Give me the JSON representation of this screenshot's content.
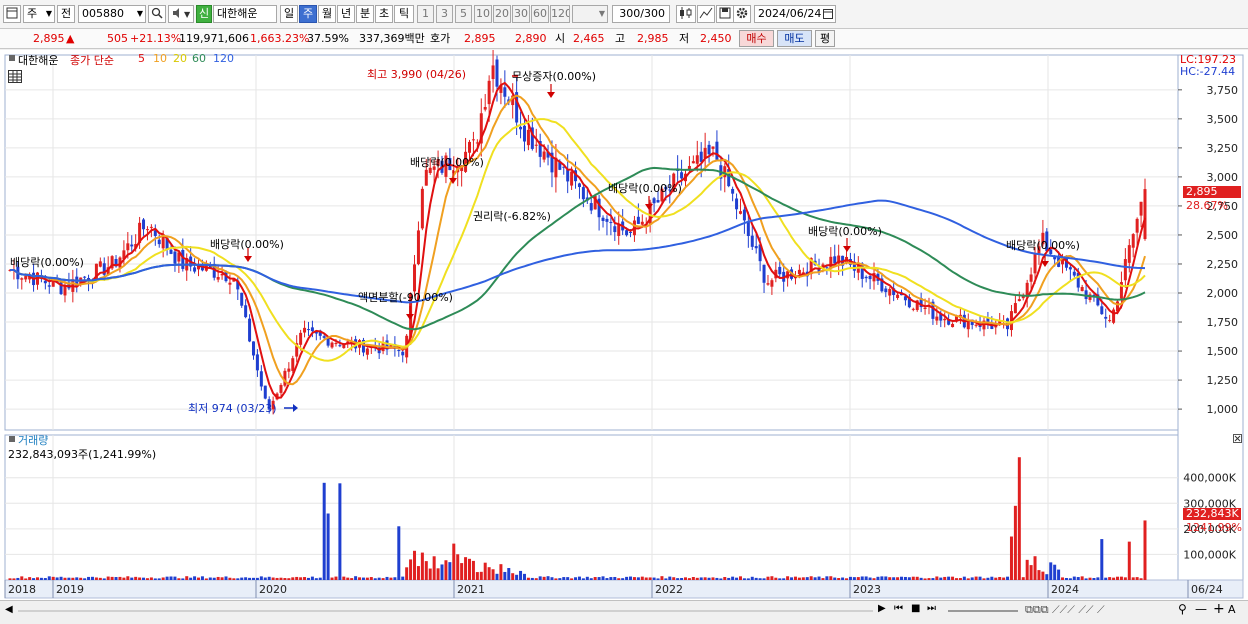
{
  "toolbar": {
    "market": "주",
    "prev": "전",
    "code": "005880",
    "new_badge": "신",
    "name": "대한해운",
    "periods": [
      "일",
      "주",
      "월",
      "년",
      "분",
      "초",
      "틱"
    ],
    "active_period": "주",
    "intervals": [
      "1",
      "3",
      "5",
      "10",
      "20",
      "30",
      "60",
      "120"
    ],
    "count": "300",
    "count_total": "/300",
    "date": "2024/06/24"
  },
  "quote": {
    "price": "2,895",
    "arrow": "▲",
    "change": "505",
    "change_pct": "+21.13%",
    "volume": "119,971,606",
    "volume_pct": "1,663.23%",
    "turnover": "37.59%",
    "amount": "337,369백만",
    "hoga_label": "호가",
    "ask": "2,895",
    "bid": "2,890",
    "open_label": "시",
    "open": "2,465",
    "high_label": "고",
    "high": "2,985",
    "low_label": "저",
    "low": "2,450",
    "buy": "매수",
    "sell": "매도",
    "eval": "평"
  },
  "price_panel": {
    "name": "대한해운",
    "ma_title": "종가 단순",
    "ma_periods": [
      "5",
      "10",
      "20",
      "60",
      "120"
    ],
    "lc": "LC:197.23",
    "hc": "HC:-27.44",
    "current_price": "2,895",
    "current_pct": "28.67%",
    "annotations": {
      "high": "최고 3,990 (04/26)",
      "low": "최저 974 (03/23)",
      "div1": "배당락(0.00%)",
      "div2": "배당락(0.00%)",
      "split": "액면분할(-90.00%)",
      "div3": "배당락(0.00%)",
      "rights": "권리락(-6.82%)",
      "bonus": "무상증자(0.00%)",
      "div4": "배당락(0.00%)",
      "div5": "배당락(0.00%)",
      "div6": "배당락(0.00%)"
    }
  },
  "volume_panel": {
    "title": "거래량",
    "value": "232,843,093주(1,241.99%)",
    "current": "232,843K",
    "current_pct": "1241.99%"
  },
  "colors": {
    "up": "#e02020",
    "down": "#1f3fd0",
    "ma5": "#e01010",
    "ma10": "#f0a020",
    "ma20": "#f0e020",
    "ma60": "#2e8b57",
    "ma120": "#3060e0"
  },
  "chart_data": {
    "type": "candlestick",
    "interval": "weekly",
    "price_axis": {
      "ticks": [
        1000,
        1250,
        1500,
        1750,
        2000,
        2250,
        2500,
        2750,
        3000,
        3250,
        3500,
        3750
      ],
      "range": [
        820,
        4050
      ]
    },
    "price_tick_labels": [
      "1,000",
      "1,250",
      "1,500",
      "1,750",
      "2,000",
      "2,250",
      "2,500",
      "2,750",
      "3,000",
      "3,250",
      "3,500",
      "3,750"
    ],
    "volume_axis": {
      "ticks": [
        100000,
        200000,
        300000,
        400000
      ],
      "unit": "K"
    },
    "volume_tick_labels": [
      "100,000K",
      "200,000K",
      "300,000K",
      "400,000K"
    ],
    "x_labels": [
      "2018",
      "2019",
      "2020",
      "2021",
      "2022",
      "2023",
      "2024",
      "06/24"
    ],
    "ohlc_anchors": [
      {
        "date": "2018-12",
        "close": 2200
      },
      {
        "date": "2019-03",
        "close": 2050
      },
      {
        "date": "2019-06",
        "close": 2250
      },
      {
        "date": "2019-08",
        "close": 2600
      },
      {
        "date": "2019-10",
        "close": 2250
      },
      {
        "date": "2020-01",
        "close": 2150
      },
      {
        "date": "2020-03",
        "close": 974
      },
      {
        "date": "2020-05",
        "close": 1650
      },
      {
        "date": "2020-08",
        "close": 1550
      },
      {
        "date": "2020-11",
        "close": 1500
      },
      {
        "date": "2020-12",
        "close": 3000
      },
      {
        "date": "2021-03",
        "close": 3250
      },
      {
        "date": "2021-04",
        "close": 3990
      },
      {
        "date": "2021-06",
        "close": 3400
      },
      {
        "date": "2021-09",
        "close": 2900
      },
      {
        "date": "2021-12",
        "close": 2500
      },
      {
        "date": "2022-03",
        "close": 3000
      },
      {
        "date": "2022-05",
        "close": 3200
      },
      {
        "date": "2022-08",
        "close": 2100
      },
      {
        "date": "2022-12",
        "close": 2300
      },
      {
        "date": "2023-06",
        "close": 1800
      },
      {
        "date": "2023-10",
        "close": 1700
      },
      {
        "date": "2023-12",
        "close": 2450
      },
      {
        "date": "2024-02",
        "close": 2100
      },
      {
        "date": "2024-04",
        "close": 1750
      },
      {
        "date": "2024-06",
        "close": 2895
      }
    ],
    "moving_averages": [
      "MA5",
      "MA10",
      "MA20",
      "MA60",
      "MA120"
    ]
  }
}
